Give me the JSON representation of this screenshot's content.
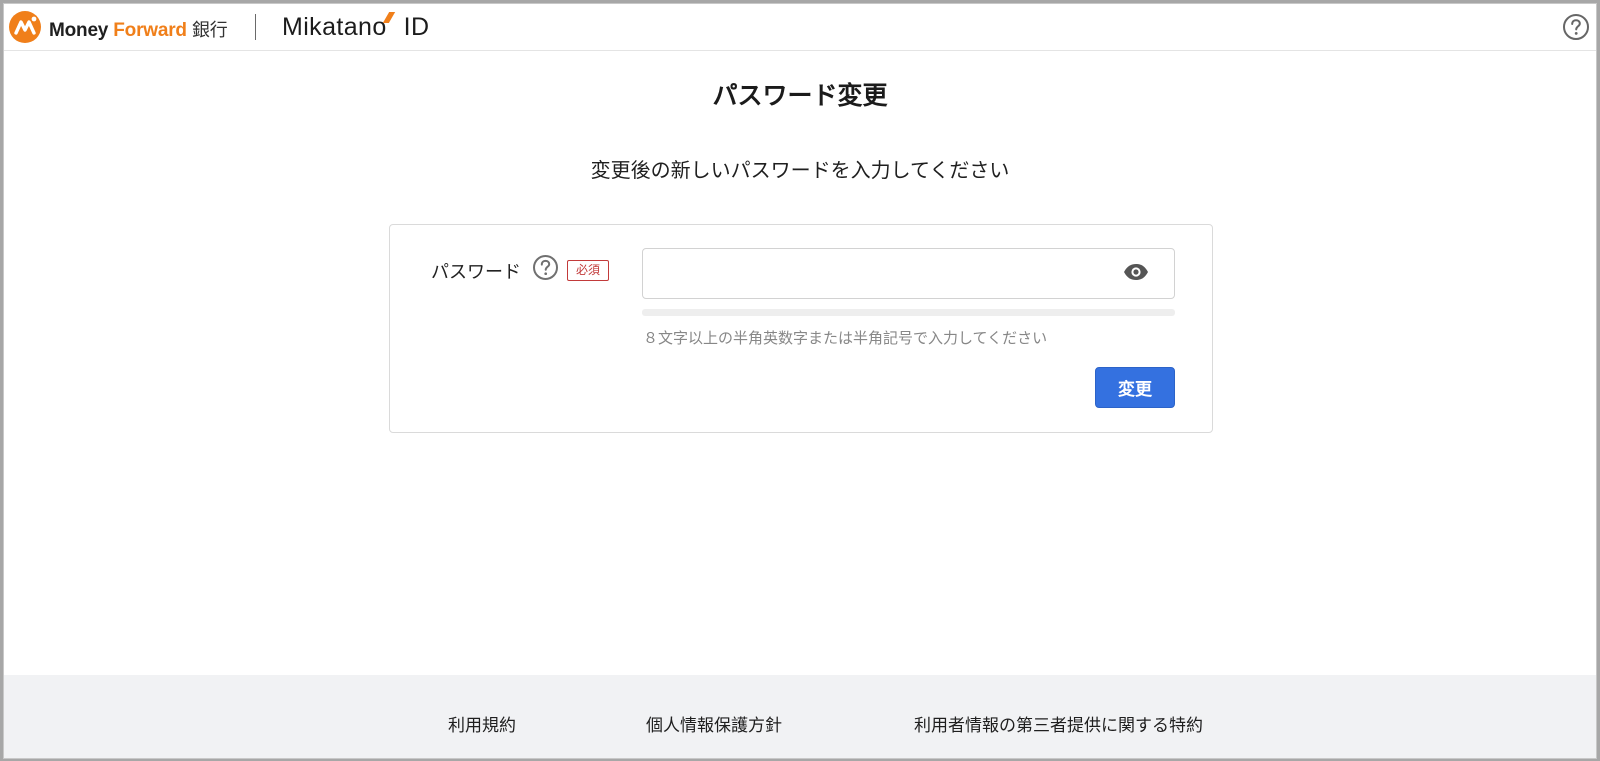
{
  "header": {
    "brand_word1": "Money",
    "brand_word2": "Forward",
    "brand_word3": "銀行",
    "product_name_a": "Mikatano",
    "product_name_b": "ID",
    "help_icon": "question-circle-icon"
  },
  "main": {
    "title": "パスワード変更",
    "subtitle": "変更後の新しいパスワードを入力してください",
    "password_label": "パスワード",
    "required_badge": "必須",
    "password_value": "",
    "hint": "８文字以上の半角英数字または半角記号で入力してください",
    "submit_label": "変更",
    "password_strength": 0
  },
  "footer": {
    "links": [
      "利用規約",
      "個人情報保護方針",
      "利用者情報の第三者提供に関する特約"
    ]
  },
  "colors": {
    "accent": "#3471e0",
    "brand_orange": "#f07f1a",
    "required_red": "#c23a3a",
    "footer_bg": "#f1f2f4"
  }
}
